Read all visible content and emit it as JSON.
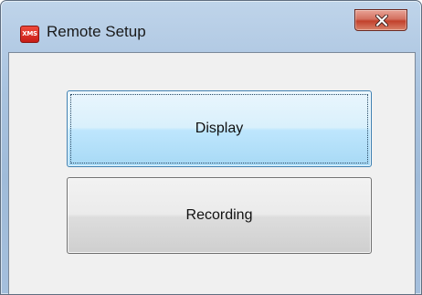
{
  "window": {
    "title": "Remote Setup",
    "app_icon": {
      "name": "xms-app-icon",
      "text": "XMS",
      "color": "#d8261c"
    },
    "close_icon": "close-icon"
  },
  "buttons": {
    "display_label": "Display",
    "recording_label": "Recording"
  },
  "colors": {
    "frame": "#a9c3df",
    "client_bg": "#f0f0f0",
    "close_button": "#c2412c",
    "focused_button": "#bee6fd"
  }
}
